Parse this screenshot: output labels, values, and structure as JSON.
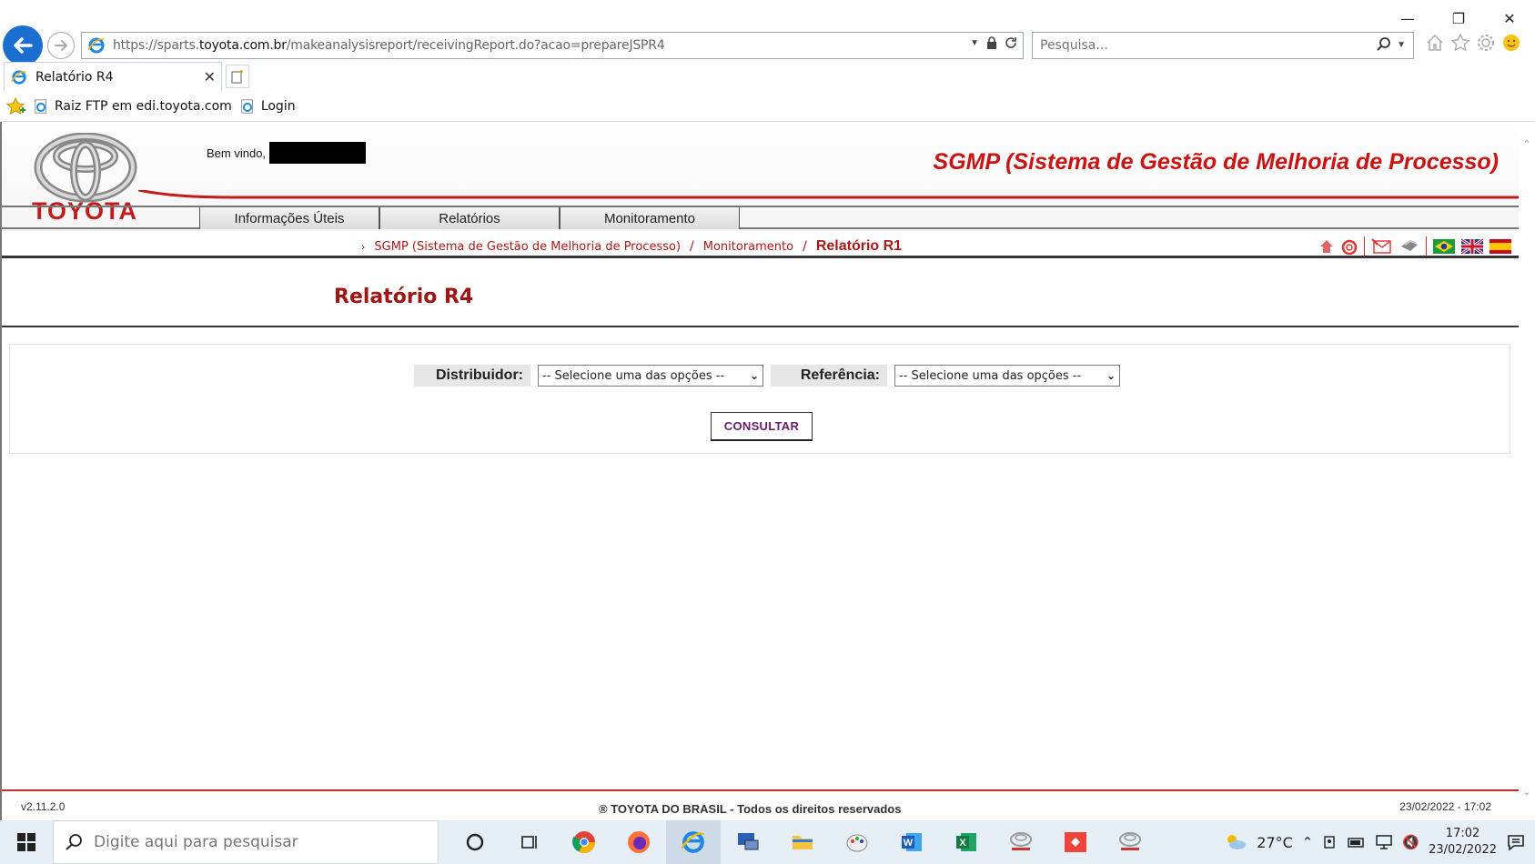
{
  "browser": {
    "url_prefix": "https://sparts.",
    "url_domain": "toyota.com.br",
    "url_rest": "/makeanalysisreport/receivingReport.do?acao=prepareJSPR4",
    "search_placeholder": "Pesquisa...",
    "tab_title": "Relatório R4",
    "favorites": [
      "Raiz FTP em edi.toyota.com",
      "Login"
    ]
  },
  "header": {
    "logo_text": "TOYOTA",
    "welcome_label": "Bem vindo,",
    "app_title": "SGMP (Sistema de Gestão de Melhoria de Processo)"
  },
  "menu": [
    "Informações Úteis",
    "Relatórios",
    "Monitoramento"
  ],
  "breadcrumb": {
    "items": [
      "SGMP (Sistema de Gestão de Melhoria de Processo)",
      "Monitoramento"
    ],
    "current": "Relatório R1"
  },
  "page": {
    "title": "Relatório R4"
  },
  "form": {
    "distribuidor_label": "Distribuidor:",
    "distribuidor_value": "-- Selecione uma das opções --",
    "referencia_label": "Referência:",
    "referencia_value": "-- Selecione uma das opções --",
    "submit_label": "CONSULTAR"
  },
  "footer": {
    "version": "v2.11.2.0",
    "copyright": "® TOYOTA DO BRASIL - Todos os direitos reservados",
    "datetime": "23/02/2022 - 17:02"
  },
  "taskbar": {
    "search_placeholder": "Digite aqui para pesquisar",
    "temperature": "27°C",
    "time": "17:02",
    "date": "23/02/2022"
  },
  "colors": {
    "brand_red": "#c41a1a",
    "link_red": "#b01818",
    "ie_blue": "#1b6fce"
  }
}
